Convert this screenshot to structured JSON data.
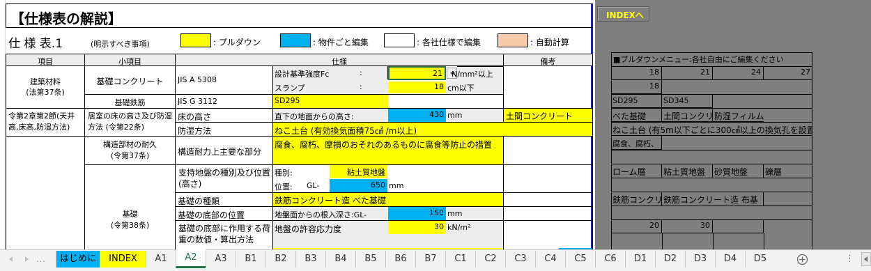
{
  "sheet": {
    "title": "【仕様表の解説】",
    "spec_title": "仕 様 表.1",
    "spec_note": "(明示すべき事項)",
    "legend": [
      {
        "label": ": プルダウン",
        "color": "#ffff00"
      },
      {
        "label": ": 物件ごと編集",
        "color": "#00b0f0"
      },
      {
        "label": ": 各社仕様で編集",
        "color": "#ffffff"
      },
      {
        "label": ": 自動計算",
        "color": "#f8cbad"
      }
    ],
    "headers": {
      "item": "項目",
      "subitem": "小項目",
      "spec": "仕様",
      "remarks": "備考"
    },
    "rows": {
      "building_material": "建築材料\n(法第37条)",
      "foundation_concrete": "基礎コンクリート",
      "jis_a": "JIS A 5308",
      "design_strength_label": "設計基準強度Fc",
      "colon": ":",
      "design_strength_value": "21",
      "design_strength_unit": "N/mm²以上",
      "slump_label": "スランプ",
      "slump_value": "18",
      "slump_unit": "cm以下",
      "rebar": "基礎鉄筋",
      "jis_g": "JIS G 3112",
      "rebar_value": "SD295",
      "article_group": "令第2章第2節(天井高,床高,防湿方法)",
      "floor_moisture": "居室の床の高さ及び防湿方法 (令第22条)",
      "floor_height": "床の高さ",
      "ground_height_label": "直下の地面からの高さ:",
      "ground_height_value": "430",
      "ground_height_unit": "mm",
      "remark_concrete": "土間コンクリート",
      "moisture_method": "防湿方法",
      "moisture_value": "ねこ土台 (有効換気面積75㎠ /m以上)",
      "durability": "構造部材の耐久\n(令第37条)",
      "durability_sub": "構造耐力上主要な部分",
      "durability_value": "腐食、腐朽、摩損のおそれのあるものに腐食等防止の措置",
      "foundation": "基礎\n(令第38条)",
      "bearing_layer": "支持地盤の種別及び位置(高さ)",
      "type_label": "種別:",
      "type_value": "粘土質地盤",
      "position_label": "位置:",
      "gl_label": "GL-",
      "position_value": "650",
      "position_unit": "mm",
      "foundation_type": "基礎の種類",
      "foundation_type_value": "鉄筋コンクリート造 べた基礎",
      "foundation_bottom": "基礎の底部の位置",
      "embed_label": "地盤面からの根入深さ:GL-",
      "embed_value": "150",
      "embed_unit": "mm",
      "bottom_load": "基礎の底部に作用する荷重の数値・算出方法",
      "bearing_label": "地盤の許容応力度",
      "bearing_value": "30",
      "bearing_unit": "kN/m²"
    }
  },
  "index_button": "INDEXへ",
  "pulldown_menu": {
    "title": "■プルダウンメニュー:各社自由にご編集ください",
    "row1": [
      "18",
      "21",
      "24",
      "27"
    ],
    "row2": [
      "18"
    ],
    "row3": [
      "SD295",
      "SD345"
    ],
    "row4": [
      "べた基礎",
      "土間コンクリ",
      "防湿フィルム"
    ],
    "row5": "ねこ土台 (有5m以下ごとに300㎠以上の換気孔を設置",
    "row6": "腐食、腐朽、",
    "row8": [
      "ローム層",
      "粘土質地盤",
      "砂質地盤",
      "礫層"
    ],
    "row10": [
      "鉄筋コンクリ",
      "鉄筋コンクリート造 布基"
    ],
    "row12": [
      "20",
      "30"
    ]
  },
  "tabs": [
    {
      "label": "はじめに",
      "color": "#00b0f0"
    },
    {
      "label": "INDEX",
      "color": "#ffff00"
    },
    {
      "label": "A1"
    },
    {
      "label": "A2",
      "active": true
    },
    {
      "label": "A3"
    },
    {
      "label": "B1"
    },
    {
      "label": "B2"
    },
    {
      "label": "B3"
    },
    {
      "label": "B4"
    },
    {
      "label": "B5"
    },
    {
      "label": "B6"
    },
    {
      "label": "B7"
    },
    {
      "label": "C1"
    },
    {
      "label": "C2"
    },
    {
      "label": "C3"
    },
    {
      "label": "C4"
    },
    {
      "label": "C5"
    },
    {
      "label": "C6"
    },
    {
      "label": "D1"
    },
    {
      "label": "D2"
    },
    {
      "label": "D3"
    },
    {
      "label": "D4"
    },
    {
      "label": "D5"
    }
  ],
  "icons": {
    "add_sheet": "plus-circle-icon",
    "nav": "triangle-arrow-icon",
    "dropdown": "dropdown-arrow-icon"
  }
}
